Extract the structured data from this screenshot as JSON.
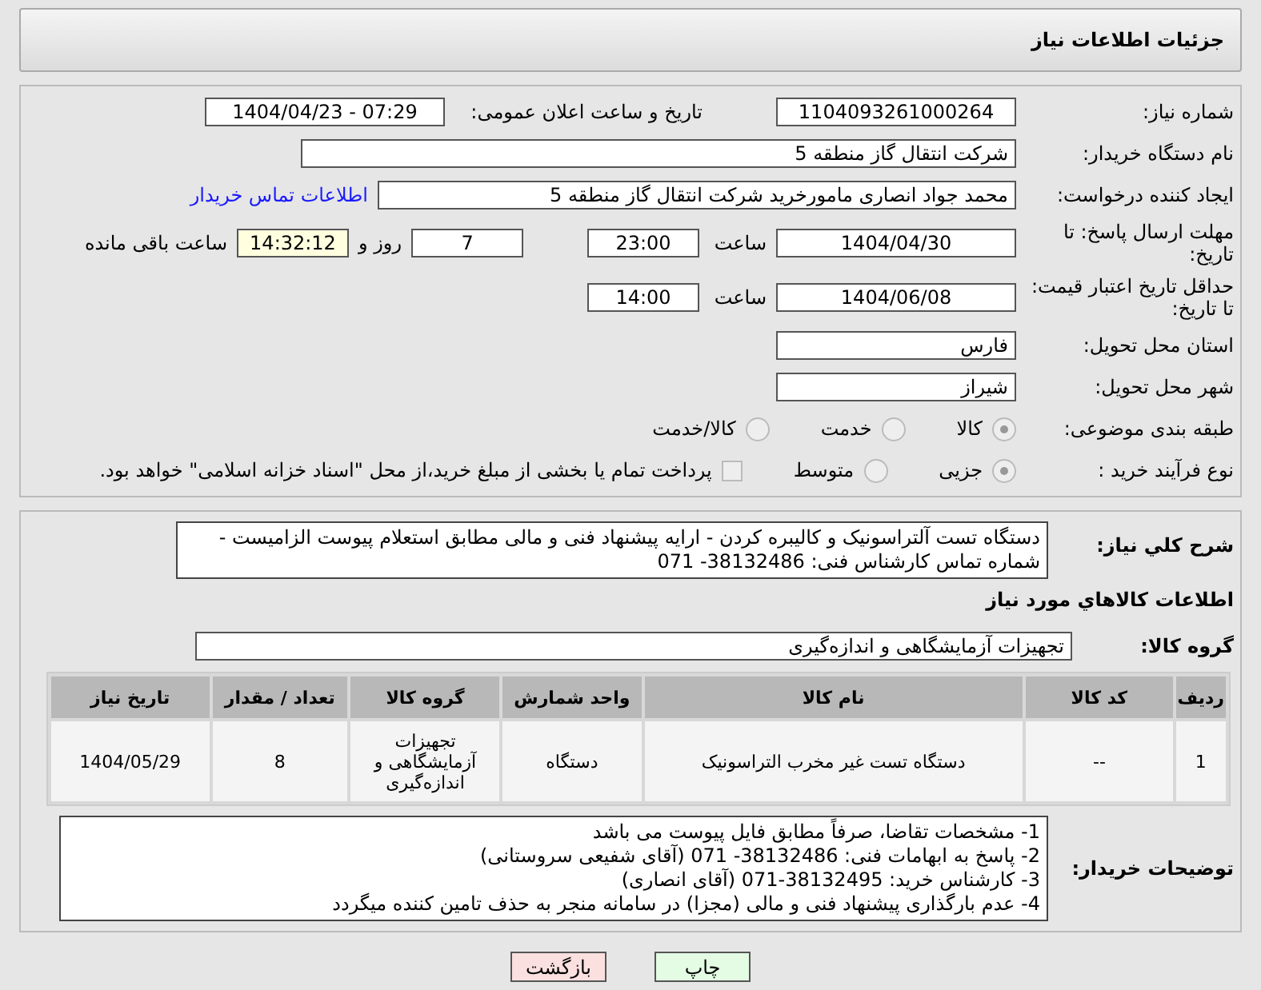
{
  "header": {
    "title": "جزئیات اطلاعات نیاز"
  },
  "details": {
    "need_number": {
      "label": "شماره نیاز:",
      "value": "1104093261000264"
    },
    "announce_datetime": {
      "label": "تاریخ و ساعت اعلان عمومی:",
      "value": "1404/04/23 - 07:29"
    },
    "buyer_org": {
      "label": "نام دستگاه خریدار:",
      "value": "شرکت انتقال گاز منطقه 5"
    },
    "requester": {
      "label": "ایجاد کننده درخواست:",
      "value": "محمد جواد انصاری مامورخرید شرکت انتقال گاز منطقه 5",
      "link": "اطلاعات تماس خریدار"
    },
    "response_deadline": {
      "label": "مهلت ارسال پاسخ: تا تاریخ:",
      "date": "1404/04/30",
      "time_label": "ساعت",
      "time": "23:00",
      "days": "7",
      "days_label": "روز و",
      "remaining": "14:32:12",
      "remaining_label": "ساعت باقی مانده"
    },
    "price_validity": {
      "label": "حداقل تاریخ اعتبار قیمت: تا تاریخ:",
      "date": "1404/06/08",
      "time_label": "ساعت",
      "time": "14:00"
    },
    "province": {
      "label": "استان محل تحویل:",
      "value": "فارس"
    },
    "city": {
      "label": "شهر محل تحویل:",
      "value": "شیراز"
    },
    "category": {
      "label": "طبقه بندی موضوعی:",
      "options": [
        {
          "label": "کالا",
          "selected": true
        },
        {
          "label": "خدمت",
          "selected": false
        },
        {
          "label": "کالا/خدمت",
          "selected": false
        }
      ]
    },
    "process": {
      "label": "نوع فرآیند خرید :",
      "options": [
        {
          "label": "جزیی",
          "selected": true
        },
        {
          "label": "متوسط",
          "selected": false
        }
      ],
      "payment_note": {
        "text": "پرداخت تمام یا بخشی از مبلغ خرید،از محل \"اسناد خزانه اسلامی\" خواهد بود.",
        "checked": false
      }
    }
  },
  "needs": {
    "description": {
      "label": "شرح کلي نياز:",
      "value": "دستگاه تست آلتراسونیک و کالیبره کردن - ارایه پیشنهاد فنی و مالی مطابق استعلام پیوست الزامیست - شماره تماس کارشناس فنی: 38132486- 071"
    },
    "section_title": "اطلاعات کالاهاي مورد نياز",
    "goods_group": {
      "label": "گروه کالا:",
      "value": "تجهیزات آزمایشگاهی و اندازه‌گیری"
    },
    "table": {
      "columns": [
        "ردیف",
        "کد کالا",
        "نام کالا",
        "واحد شمارش",
        "گروه کالا",
        "تعداد / مقدار",
        "تاریخ نیاز"
      ],
      "rows": [
        [
          "1",
          "--",
          "دستگاه تست غیر مخرب التراسونیک",
          "دستگاه",
          "تجهیزات آزمایشگاهی و اندازه‌گیری",
          "8",
          "1404/05/29"
        ]
      ]
    },
    "buyer_notes": {
      "label": "توضیحات خریدار:",
      "lines": [
        "1-  مشخصات تقاضا، صرفاً مطابق فایل پیوست می باشد",
        "2- پاسخ به ابهامات فنی: 38132486- 071 (آقای شفیعی سروستانی)",
        "3- کارشناس خرید: 38132495-071 (آقای انصاری)",
        "4- عدم بارگذاری پیشنهاد فنی و مالی (مجزا) در سامانه منجر به حذف تامین کننده میگردد"
      ]
    }
  },
  "buttons": [
    {
      "label": "چاپ",
      "kind": "print"
    },
    {
      "label": "بازگشت",
      "kind": "back"
    }
  ]
}
